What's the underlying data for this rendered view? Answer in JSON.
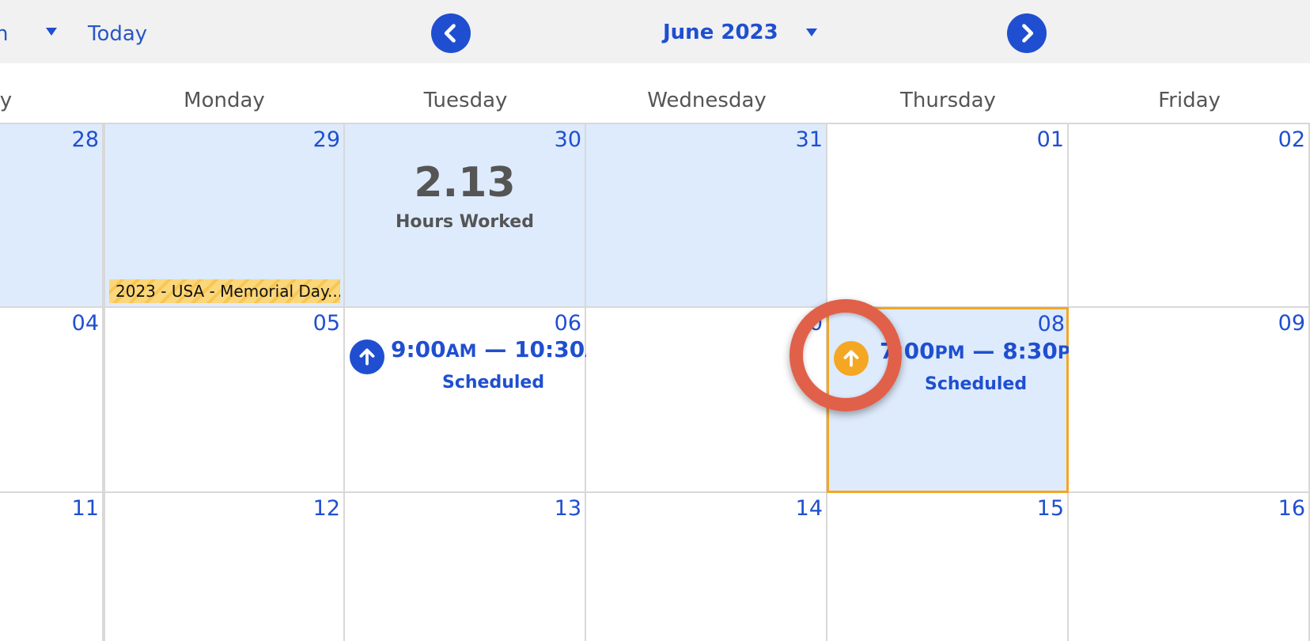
{
  "toolbar": {
    "view_fragment": "h",
    "today_label": "Today",
    "month_label": "June 2023"
  },
  "weekdays": [
    "ay",
    "Monday",
    "Tuesday",
    "Wednesday",
    "Thursday",
    "Friday"
  ],
  "weeks": [
    {
      "days": [
        {
          "num": "28"
        },
        {
          "num": "29",
          "holiday": "2023 - USA - Memorial Day..."
        },
        {
          "num": "30",
          "hours_value": "2.13",
          "hours_label": "Hours Worked"
        },
        {
          "num": "31"
        },
        {
          "num": "01"
        },
        {
          "num": "02"
        }
      ]
    },
    {
      "days": [
        {
          "num": "04"
        },
        {
          "num": "05"
        },
        {
          "num": "06",
          "shift": {
            "start": "9:00",
            "start_ampm": "AM",
            "sep": " — ",
            "end": "10:30",
            "end_ampm": "AM",
            "status": "Scheduled"
          }
        },
        {
          "num": "0"
        },
        {
          "num": "08",
          "shift": {
            "start": "7:00",
            "start_ampm": "PM",
            "sep": " — ",
            "end": "8:30",
            "end_ampm": "PM",
            "status": "Scheduled"
          }
        },
        {
          "num": "09"
        }
      ]
    },
    {
      "days": [
        {
          "num": "11"
        },
        {
          "num": "12"
        },
        {
          "num": "13"
        },
        {
          "num": "14"
        },
        {
          "num": "15"
        },
        {
          "num": "16"
        }
      ]
    }
  ],
  "colors": {
    "primary": "#1f4fd0",
    "shaded_day": "#deebfc",
    "selected_border": "#f5a623",
    "holiday": "#fbd77b",
    "highlight_ring": "#e0604a",
    "pending_icon": "#f5a623"
  },
  "icons": {
    "prev": "chevron-left-icon",
    "next": "chevron-right-icon",
    "shift_confirmed": "arrow-up-icon",
    "shift_pending": "arrow-up-icon"
  }
}
